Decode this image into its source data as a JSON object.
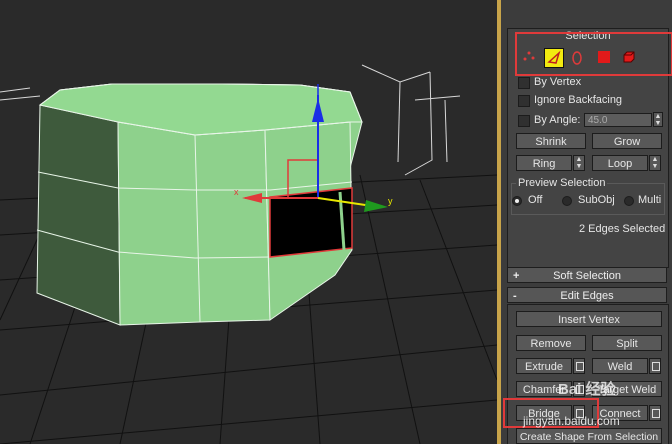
{
  "viewport": {
    "axis_x_label": "x",
    "axis_y_label": "y"
  },
  "selection": {
    "title": "Selection",
    "modes": [
      {
        "name": "vertex-mode-icon"
      },
      {
        "name": "edge-mode-icon"
      },
      {
        "name": "border-mode-icon"
      },
      {
        "name": "polygon-mode-icon"
      },
      {
        "name": "element-mode-icon"
      }
    ],
    "by_vertex": "By Vertex",
    "ignore_backfacing": "Ignore Backfacing",
    "by_angle": "By Angle:",
    "angle_value": "45.0",
    "shrink": "Shrink",
    "grow": "Grow",
    "ring": "Ring",
    "loop": "Loop",
    "preview_title": "Preview Selection",
    "preview_options": [
      "Off",
      "SubObj",
      "Multi"
    ],
    "status": "2 Edges Selected"
  },
  "soft_selection": {
    "sign": "+",
    "title": "Soft Selection"
  },
  "edit_edges": {
    "sign": "-",
    "title": "Edit Edges",
    "insert_vertex": "Insert Vertex",
    "remove": "Remove",
    "split": "Split",
    "extrude": "Extrude",
    "weld": "Weld",
    "chamfer": "Chamfer",
    "target_weld": "Target Weld",
    "bridge": "Bridge",
    "connect": "Connect",
    "create_shape": "Create Shape From Selection"
  },
  "watermark": {
    "brand": "Bai 经验",
    "url": "jingyan.baidu.com"
  },
  "colors": {
    "highlight": "#e03a3a",
    "mesh": "#8ed18c",
    "divider": "#c8a44a"
  }
}
